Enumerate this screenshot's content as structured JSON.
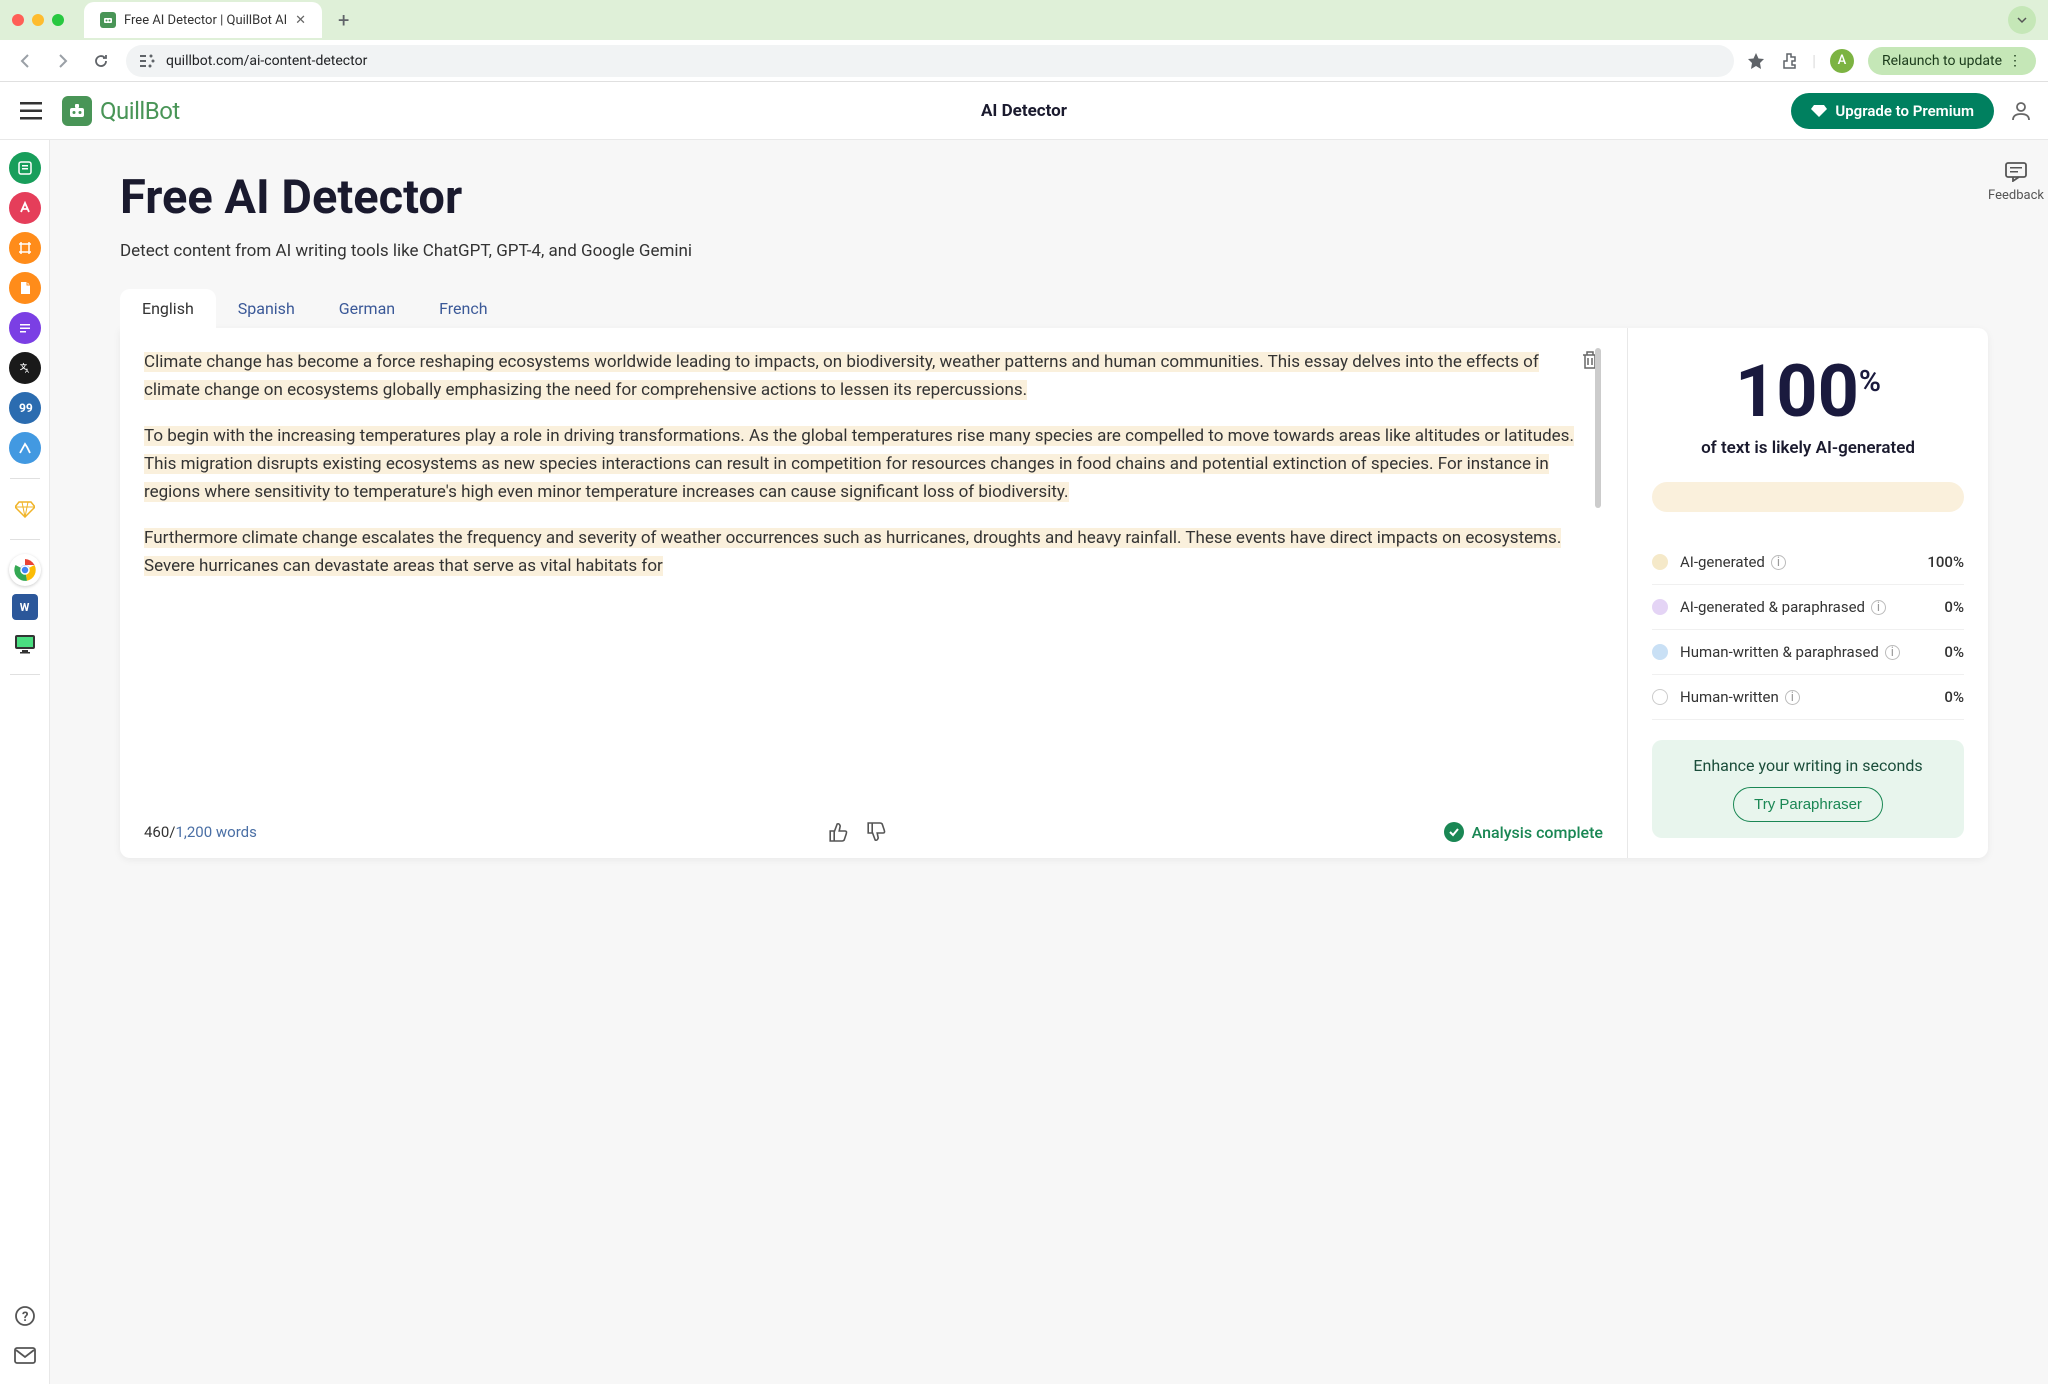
{
  "browser": {
    "tab_title": "Free AI Detector | QuillBot AI",
    "url": "quillbot.com/ai-content-detector",
    "avatar_letter": "A",
    "relaunch_label": "Relaunch to update"
  },
  "header": {
    "logo_text": "QuillBot",
    "title": "AI Detector",
    "premium_label": "Upgrade to Premium"
  },
  "page": {
    "title": "Free AI Detector",
    "subtitle": "Detect content from AI writing tools like ChatGPT, GPT-4, and Google Gemini"
  },
  "tabs": [
    "English",
    "Spanish",
    "German",
    "French"
  ],
  "editor": {
    "para1": "Climate change has become a force reshaping ecosystems worldwide leading to impacts, on biodiversity, weather patterns and human communities. This essay delves into the effects of climate change on ecosystems globally emphasizing the need for comprehensive actions to lessen its repercussions.",
    "para2": "To begin with the increasing temperatures play a role in driving transformations. As the global temperatures rise many species are compelled to move towards areas like altitudes or latitudes. This migration disrupts existing ecosystems as new species interactions can result in competition for resources changes in food chains and potential extinction of species. For instance in regions where sensitivity to temperature's high even minor temperature increases can cause significant loss of biodiversity.",
    "para3": "Furthermore climate change escalates the frequency and severity of weather occurrences such as hurricanes, droughts and heavy rainfall. These events have direct impacts on ecosystems. Severe hurricanes can devastate areas that serve as vital habitats for",
    "word_count": "460",
    "word_limit": "1,200 words",
    "status_label": "Analysis complete"
  },
  "result": {
    "score": "100",
    "score_unit": "%",
    "score_text": "of text is likely AI-generated",
    "legend": [
      {
        "label": "AI-generated",
        "value": "100%"
      },
      {
        "label": "AI-generated & paraphrased",
        "value": "0%"
      },
      {
        "label": "Human-written & paraphrased",
        "value": "0%"
      },
      {
        "label": "Human-written",
        "value": "0%"
      }
    ],
    "enhance_text": "Enhance your writing in seconds",
    "paraphraser_label": "Try Paraphraser"
  },
  "feedback_label": "Feedback"
}
